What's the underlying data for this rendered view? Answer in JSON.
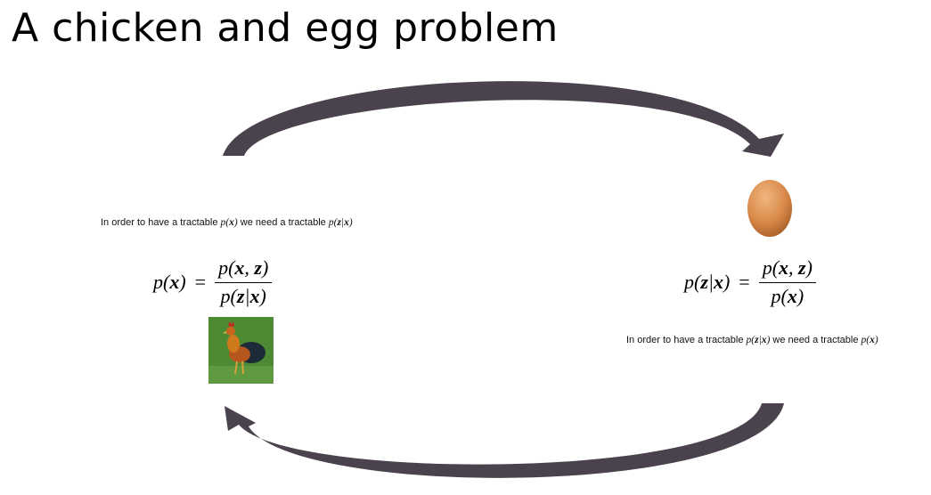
{
  "title": "A chicken and egg problem",
  "left": {
    "note": {
      "prefix": "In order to have a tractable ",
      "math1": "p(x)",
      "middle": " we need a tractable ",
      "math2": "p(z|x)"
    },
    "equation": {
      "lhs": "p(x)",
      "equals": "=",
      "numerator": "p(x, z)",
      "denominator": "p(z|x)"
    }
  },
  "right": {
    "equation": {
      "lhs": "p(z|x)",
      "equals": "=",
      "numerator": "p(x, z)",
      "denominator": "p(x)"
    },
    "note": {
      "prefix": "In order to have a tractable ",
      "math1": "p(z|x)",
      "middle": " we need a tractable ",
      "math2": "p(x)"
    }
  },
  "colors": {
    "arrow": "#4a424c",
    "egg": "#d98a4a",
    "grass": "#4d8a34"
  },
  "icons": [
    "curved-arrow-top",
    "curved-arrow-bottom",
    "egg-image",
    "rooster-image"
  ]
}
